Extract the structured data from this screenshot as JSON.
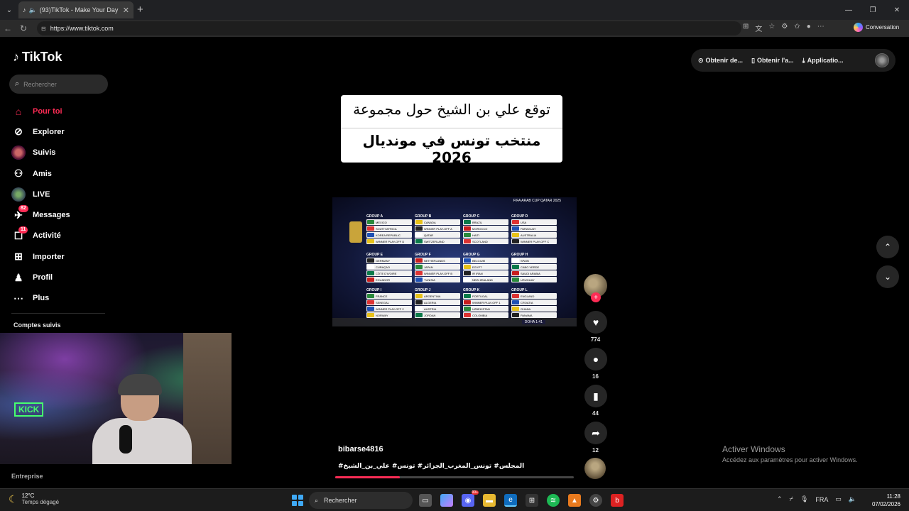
{
  "browser": {
    "tab_title": "(93)TikTok - Make Your Day",
    "url": "https://www.tiktok.com",
    "conversation_label": "Conversation"
  },
  "app": {
    "logo": "TikTok",
    "search_placeholder": "Rechercher",
    "nav": [
      {
        "label": "Pour toi",
        "icon": "home-icon",
        "active": true
      },
      {
        "label": "Explorer",
        "icon": "compass-icon"
      },
      {
        "label": "Suivis",
        "icon": "following-avatar-icon"
      },
      {
        "label": "Amis",
        "icon": "friends-icon"
      },
      {
        "label": "LIVE",
        "icon": "live-icon"
      },
      {
        "label": "Messages",
        "icon": "messages-icon",
        "badge": "82"
      },
      {
        "label": "Activité",
        "icon": "activity-icon",
        "badge": "11"
      },
      {
        "label": "Importer",
        "icon": "upload-icon"
      },
      {
        "label": "Profil",
        "icon": "profile-icon"
      },
      {
        "label": "Plus",
        "icon": "more-icon"
      }
    ],
    "following_accounts_label": "Comptes suivis",
    "footer_label": "Entreprise",
    "top_actions": [
      "Obtenir de...",
      "Obtenir l'a...",
      "Applicatio..."
    ]
  },
  "video": {
    "caption_line1": "توقع علي بن الشيخ حول مجموعة",
    "caption_line2": "منتخب تونس في مونديال 2026",
    "header_text": "FIFA ARAB CUP QATAR 2025",
    "groups": [
      {
        "title": "GROUP A",
        "teams": [
          "MEXICO",
          "SOUTH AFRICA",
          "KOREA REPUBLIC",
          "WINNER PLAY-OFF D"
        ]
      },
      {
        "title": "GROUP B",
        "teams": [
          "CANADA",
          "WINNER PLAY-OFF A",
          "QATAR",
          "SWITZERLAND"
        ]
      },
      {
        "title": "GROUP C",
        "teams": [
          "BRAZIL",
          "MOROCCO",
          "HAITI",
          "SCOTLAND"
        ]
      },
      {
        "title": "GROUP D",
        "teams": [
          "USA",
          "PARAGUAY",
          "AUSTRALIA",
          "WINNER PLAY-OFF C"
        ]
      },
      {
        "title": "GROUP E",
        "teams": [
          "GERMANY",
          "CURAÇAO",
          "CÔTE D'IVOIRE",
          "ECUADOR"
        ]
      },
      {
        "title": "GROUP F",
        "teams": [
          "NETHERLANDS",
          "JAPAN",
          "WINNER PLAY-OFF B",
          "TUNISIA"
        ]
      },
      {
        "title": "GROUP G",
        "teams": [
          "BELGIUM",
          "EGYPT",
          "IR IRAN",
          "NEW ZEALAND"
        ]
      },
      {
        "title": "GROUP H",
        "teams": [
          "SPAIN",
          "CABO VERDE",
          "SAUDI ARABIA",
          "URUGUAY"
        ]
      },
      {
        "title": "GROUP I",
        "teams": [
          "FRANCE",
          "SENEGAL",
          "WINNER PLAY-OFF 2",
          "NORWAY"
        ]
      },
      {
        "title": "GROUP J",
        "teams": [
          "ARGENTINA",
          "ALGERIA",
          "AUSTRIA",
          "JORDAN"
        ]
      },
      {
        "title": "GROUP K",
        "teams": [
          "PORTUGAL",
          "WINNER PLAY-OFF 1",
          "UZBEKISTAN",
          "COLOMBIA"
        ]
      },
      {
        "title": "GROUP L",
        "teams": [
          "ENGLAND",
          "CROATIA",
          "GHANA",
          "PANAMA"
        ]
      }
    ],
    "doha_time": "DOHA 1:41",
    "progress": 0.27,
    "likes": "774",
    "comments": "16",
    "saves": "44",
    "shares": "12",
    "username": "bibarse4816",
    "hashtags": "#المجلس# تونس_المغرب_الجزائر# تونس# علي_بن_الشيخ"
  },
  "watermark": {
    "title": "Activer Windows",
    "subtitle": "Accédez aux paramètres pour activer Windows."
  },
  "taskbar": {
    "temp": "12°C",
    "weather": "Temps dégagé",
    "search": "Rechercher",
    "lang": "FRA",
    "time": "11:28",
    "date": "07/02/2026",
    "discord_badge": "99+"
  }
}
